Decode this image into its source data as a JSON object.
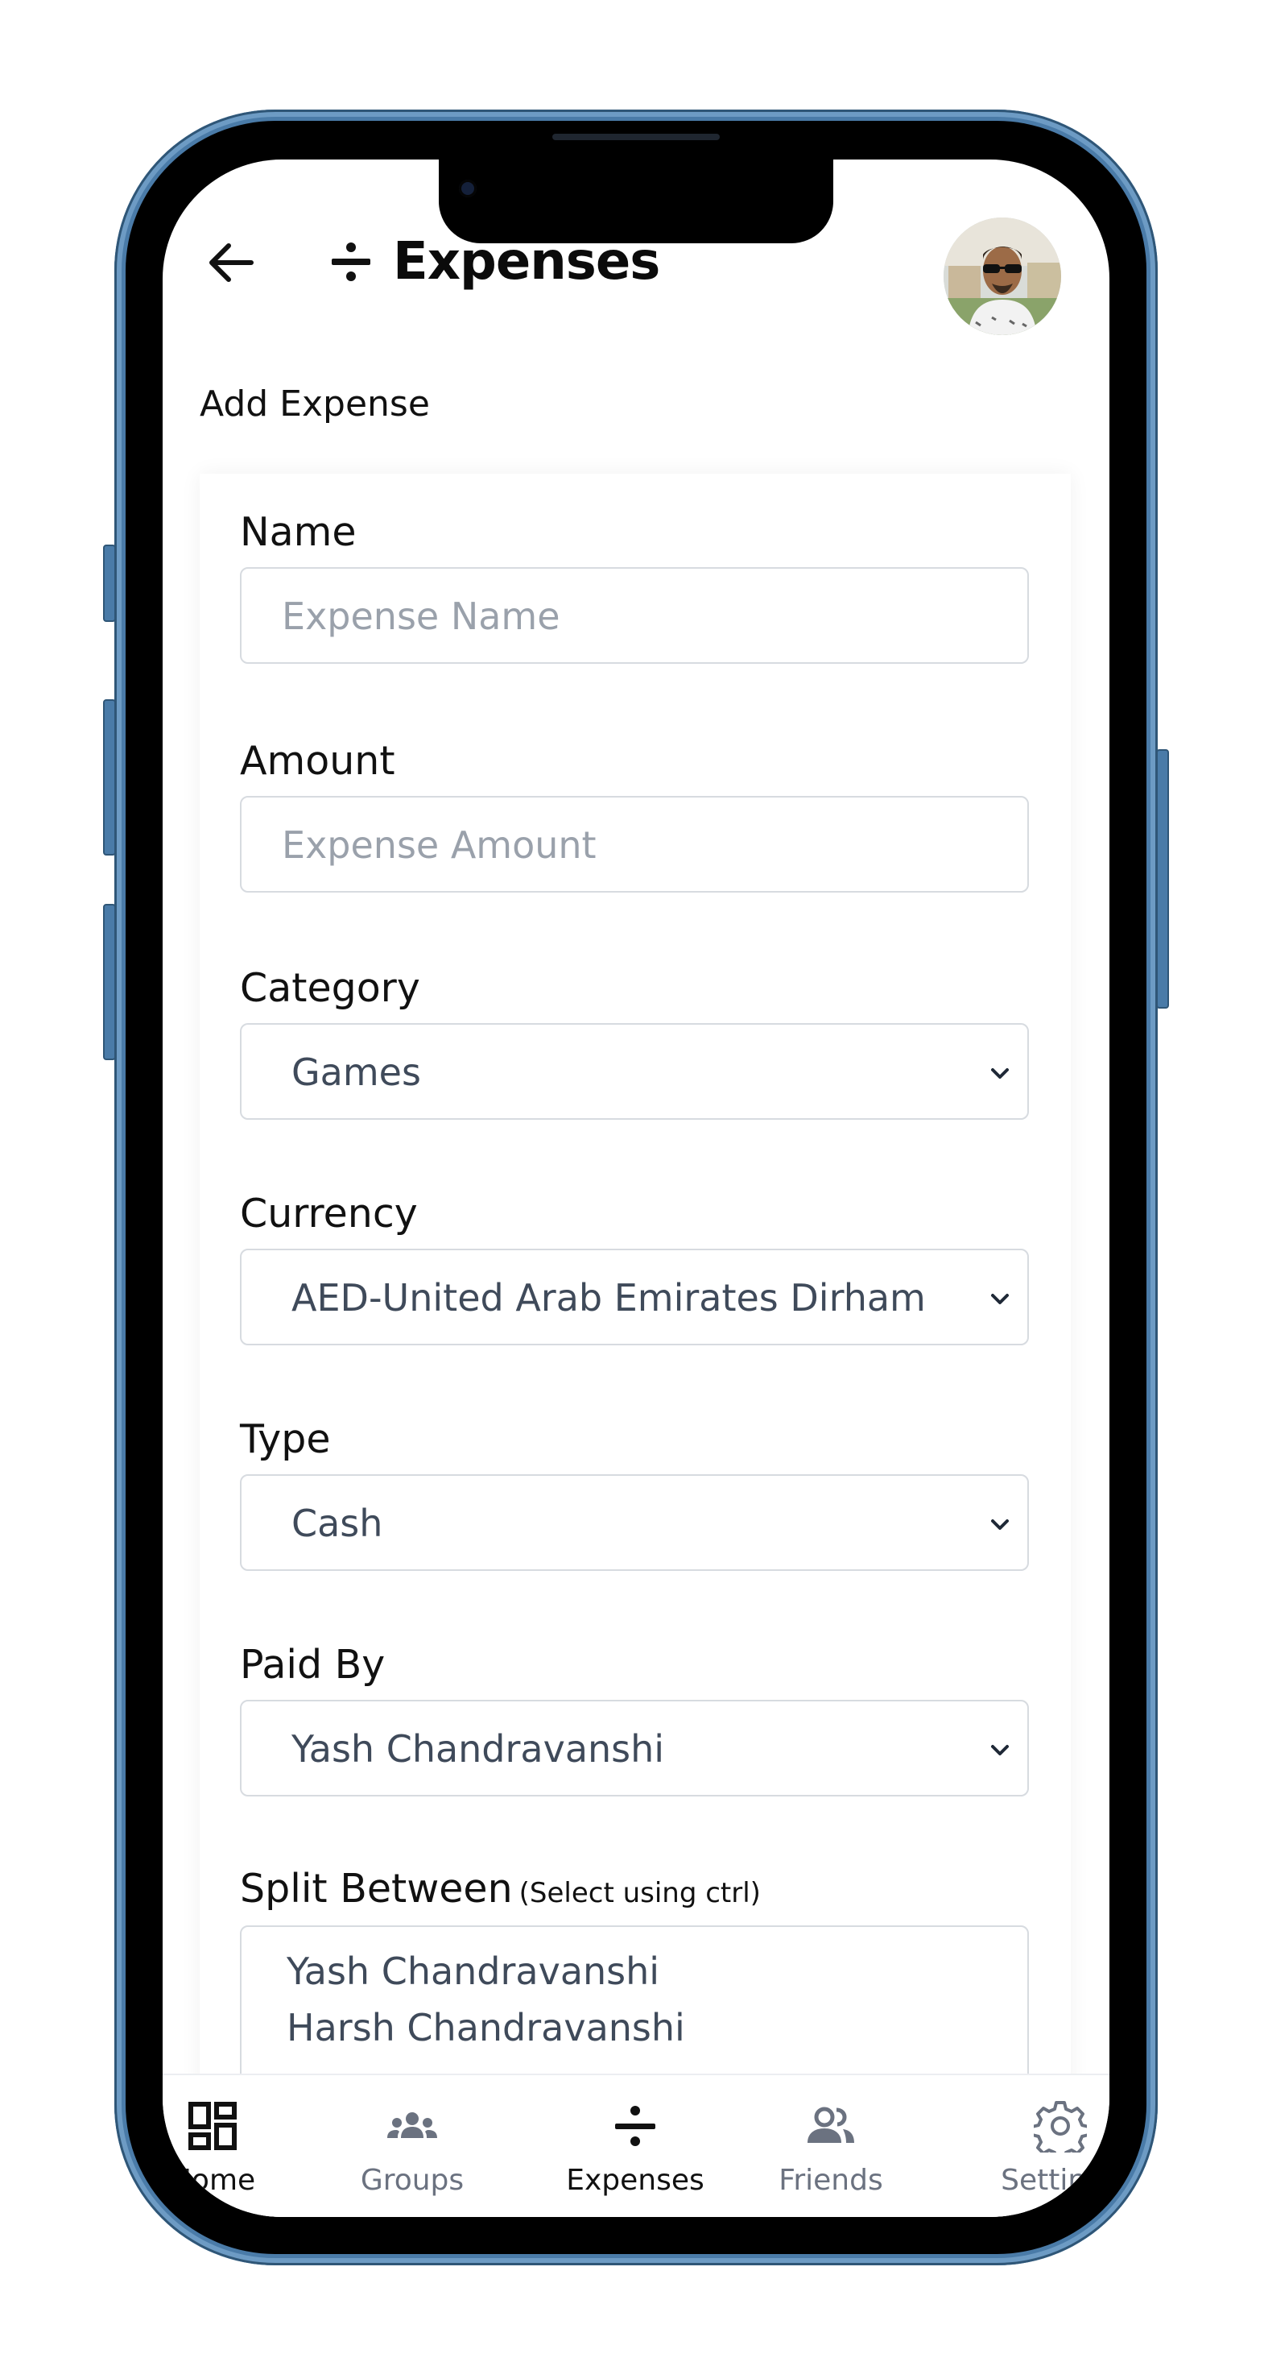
{
  "header": {
    "title": "Expenses"
  },
  "section_title": "Add Expense",
  "form": {
    "name": {
      "label": "Name",
      "placeholder": "Expense Name"
    },
    "amount": {
      "label": "Amount",
      "placeholder": "Expense Amount"
    },
    "category": {
      "label": "Category",
      "selected": "Games"
    },
    "currency": {
      "label": "Currency",
      "selected": "AED-United Arab Emirates Dirham"
    },
    "type": {
      "label": "Type",
      "selected": "Cash"
    },
    "paid_by": {
      "label": "Paid By",
      "selected": "Yash Chandravanshi"
    },
    "split_between": {
      "label": "Split Between",
      "hint": "(Select using ctrl)",
      "options": [
        "Yash Chandravanshi",
        "Harsh Chandravanshi"
      ]
    }
  },
  "bottom_nav": {
    "items": [
      {
        "label": "Home",
        "icon": "dashboard-icon"
      },
      {
        "label": "Groups",
        "icon": "groups-icon"
      },
      {
        "label": "Expenses",
        "icon": "divide-icon",
        "active": true
      },
      {
        "label": "Friends",
        "icon": "friends-icon"
      },
      {
        "label": "Settings",
        "icon": "gear-icon"
      }
    ]
  },
  "colors": {
    "frame": "#4a7ba8",
    "border": "#d7dbe0",
    "text_muted": "#6b7280",
    "placeholder": "#9aa1ab"
  }
}
